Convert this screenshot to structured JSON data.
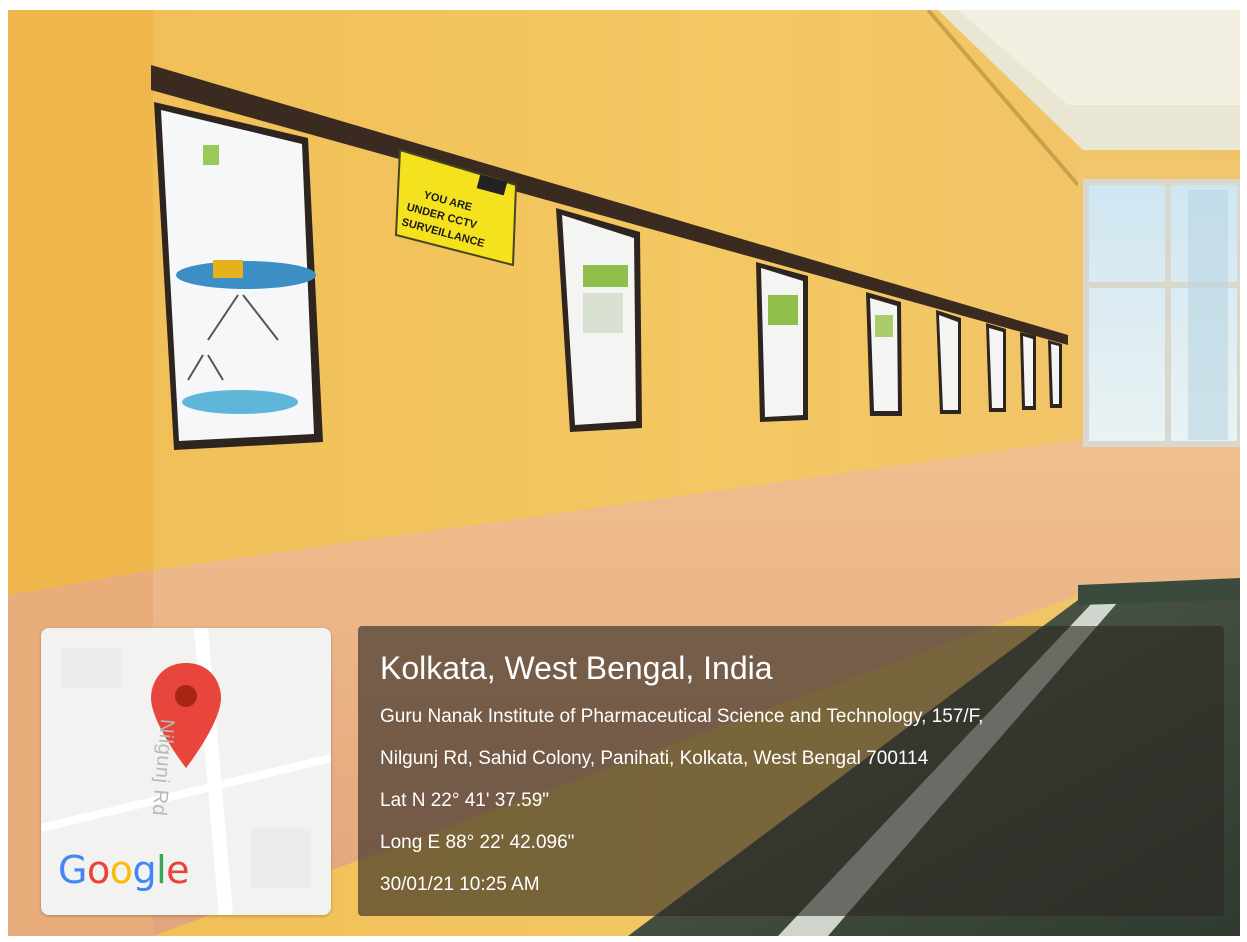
{
  "map": {
    "road_label": "Nilgunj Rd",
    "logo_text": "Google"
  },
  "location": {
    "title": "Kolkata, West Bengal, India",
    "address_line1": "Guru Nanak Institute of Pharmaceutical Science and Technology, 157/F,",
    "address_line2": "Nilgunj Rd, Sahid Colony, Panihati, Kolkata, West Bengal 700114",
    "latitude": "Lat N 22° 41' 37.59\"",
    "longitude": "Long E 88° 22' 42.096\"",
    "timestamp": "30/01/21 10:25 AM"
  },
  "signage": {
    "cctv_line1": "YOU ARE",
    "cctv_line2": "UNDER CCTV",
    "cctv_line3": "SURVEILLANCE"
  },
  "colors": {
    "wall_upper": "#f2c45a",
    "wall_lower": "#e8b088",
    "floor": "#3e4a3c",
    "pin": "#e8453c"
  }
}
